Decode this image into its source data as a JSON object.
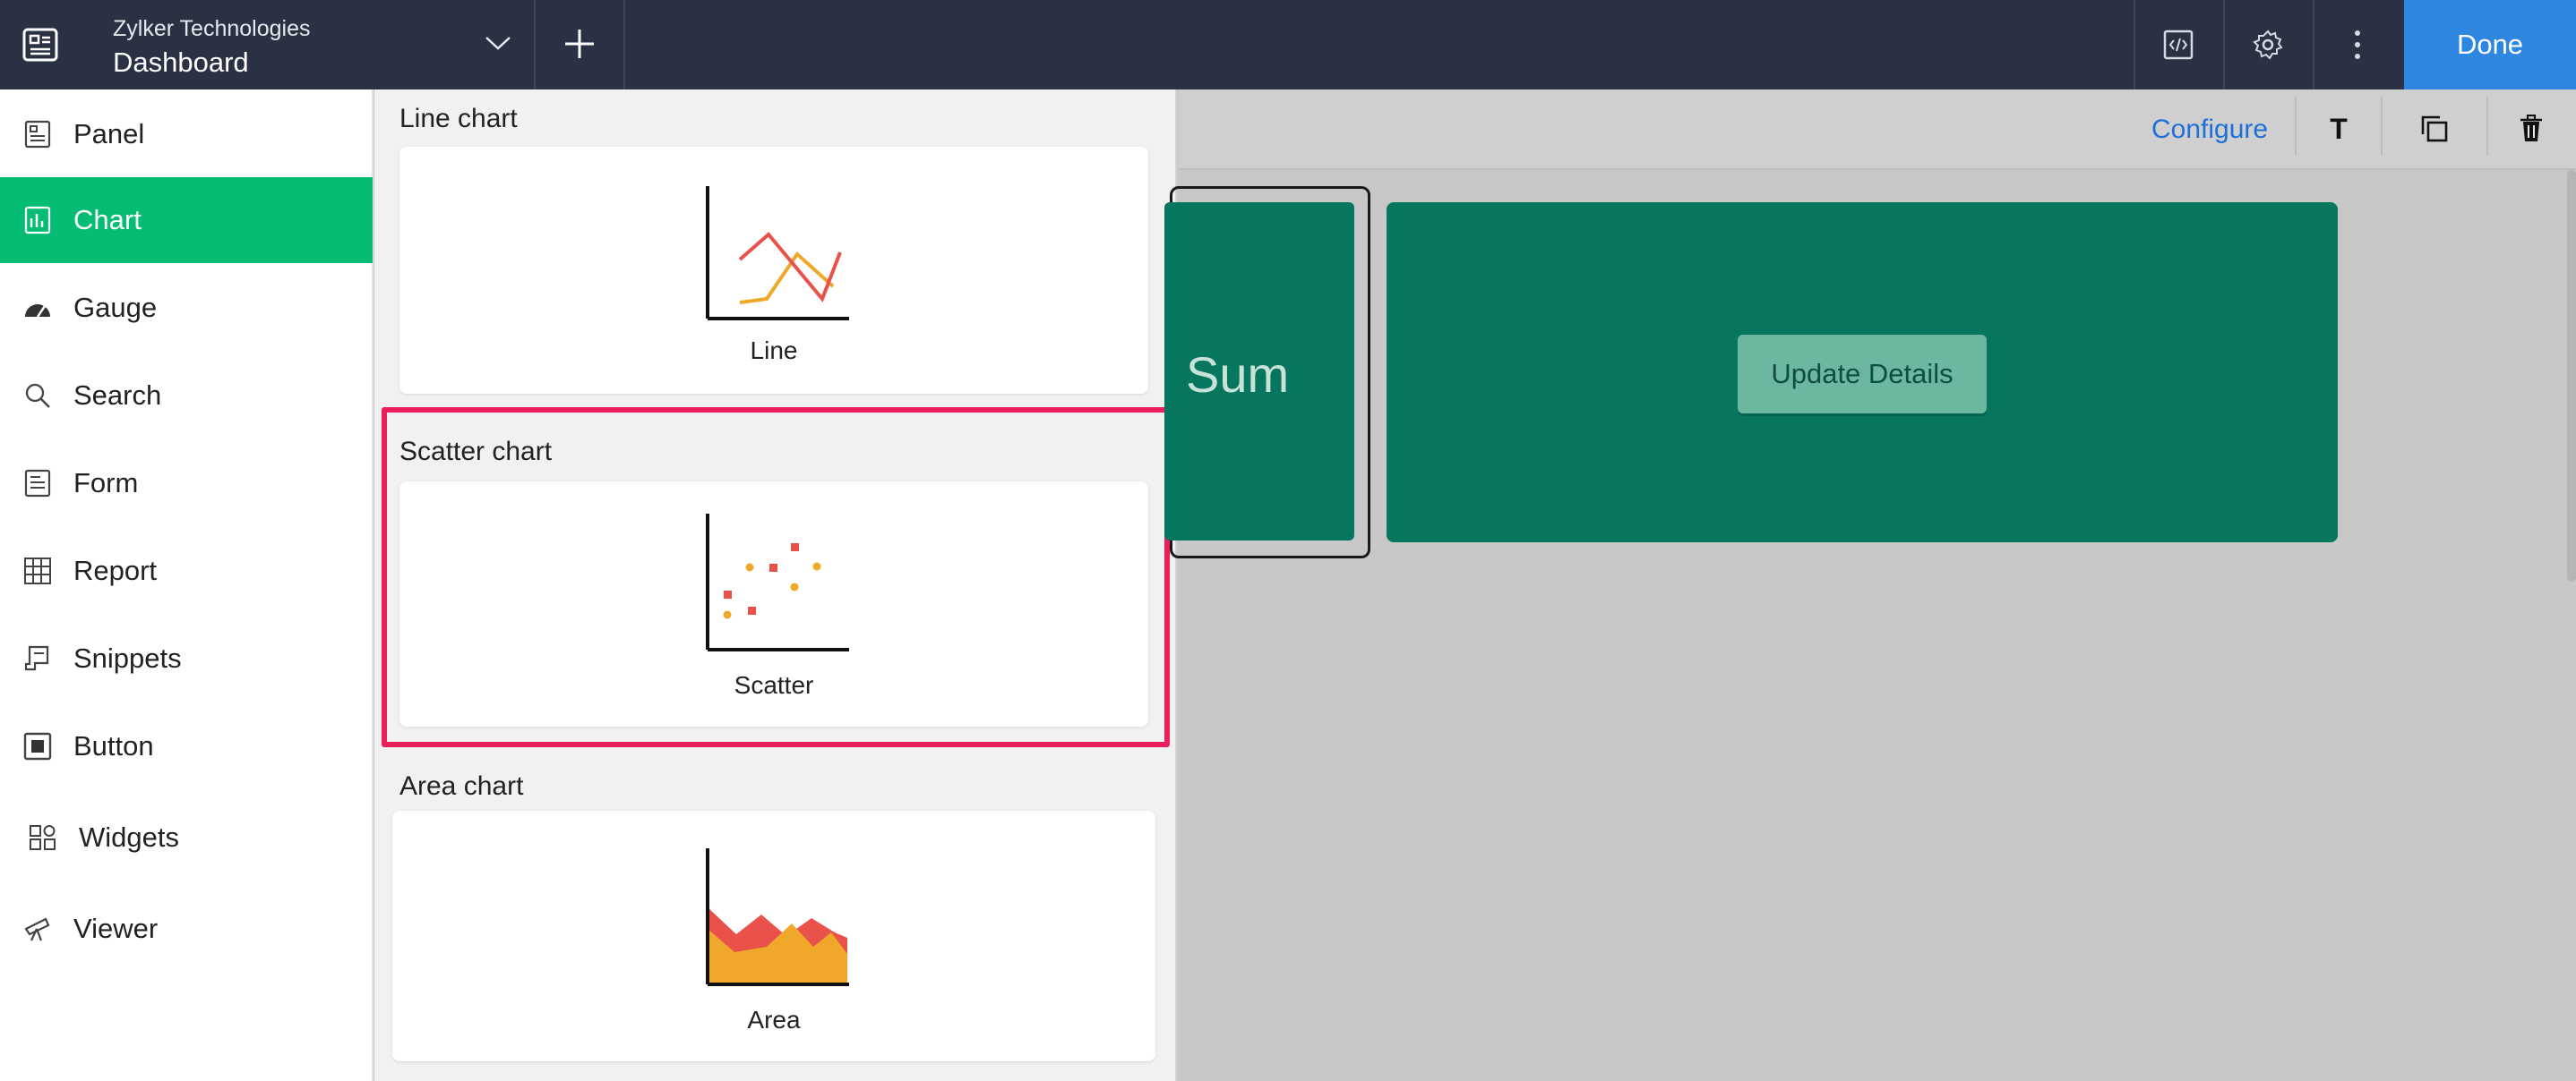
{
  "topbar": {
    "org_name": "Zylker Technologies",
    "page_title": "Dashboard",
    "done_label": "Done",
    "accent_color": "#2f86e0"
  },
  "sidebar": {
    "items": [
      {
        "label": "Panel",
        "icon": "panel-icon"
      },
      {
        "label": "Chart",
        "icon": "chart-icon",
        "active": true
      },
      {
        "label": "Gauge",
        "icon": "gauge-icon"
      },
      {
        "label": "Search",
        "icon": "search-icon"
      },
      {
        "label": "Form",
        "icon": "form-icon"
      },
      {
        "label": "Report",
        "icon": "report-icon"
      },
      {
        "label": "Snippets",
        "icon": "snippets-icon"
      },
      {
        "label": "Button",
        "icon": "button-icon"
      },
      {
        "label": "Widgets",
        "icon": "widgets-icon"
      },
      {
        "label": "Viewer",
        "icon": "viewer-icon"
      }
    ],
    "active_color": "#05bd72"
  },
  "chart_picker": {
    "sections": [
      {
        "title": "Line chart",
        "card_label": "Line"
      },
      {
        "title": "Scatter chart",
        "card_label": "Scatter",
        "highlighted": true
      },
      {
        "title": "Area chart",
        "card_label": "Area"
      }
    ],
    "highlight_color": "#ea1f5b"
  },
  "canvas": {
    "configure_label": "Configure",
    "text_tool_label": "T",
    "tile1_text": "Sum",
    "update_button_label": "Update Details",
    "tile_color": "#07765f"
  }
}
